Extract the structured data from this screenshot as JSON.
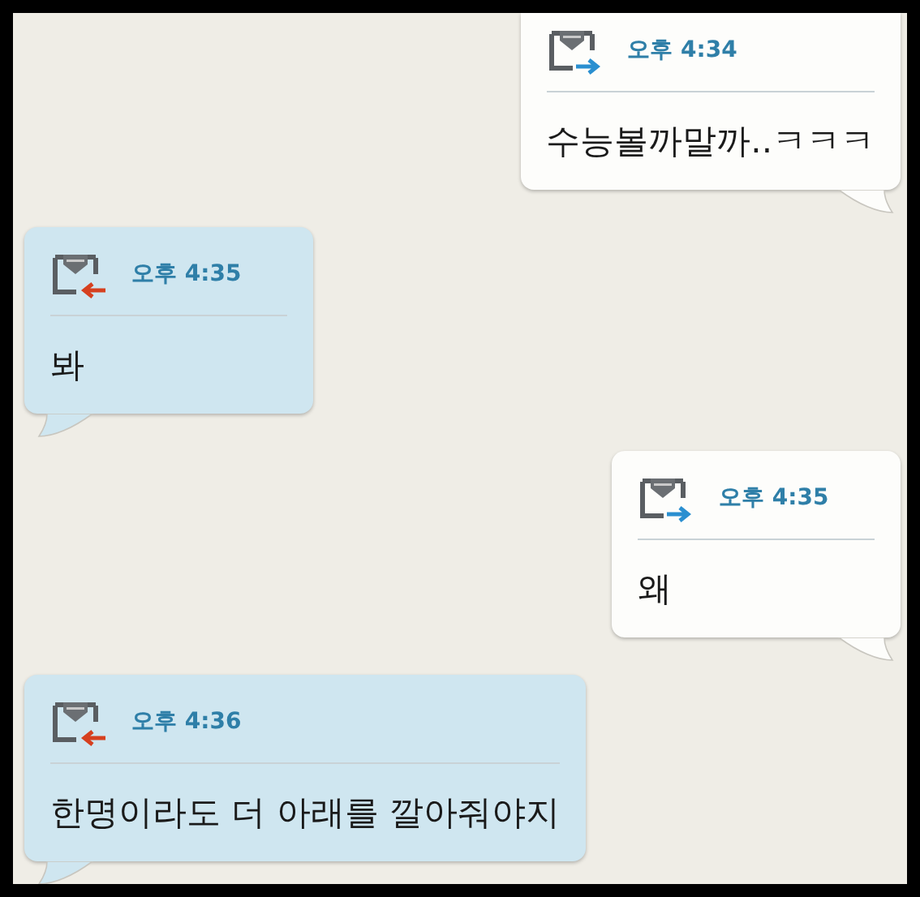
{
  "messages": [
    {
      "kind": "sent",
      "time": "오후 4:34",
      "text": "수능볼까말까..ㅋㅋㅋ"
    },
    {
      "kind": "received",
      "time": "오후 4:35",
      "text": "봐"
    },
    {
      "kind": "sent",
      "time": "오후 4:35",
      "text": "왜"
    },
    {
      "kind": "received",
      "time": "오후 4:36",
      "text": "한명이라도 더 아래를 깔아줘야지"
    }
  ]
}
